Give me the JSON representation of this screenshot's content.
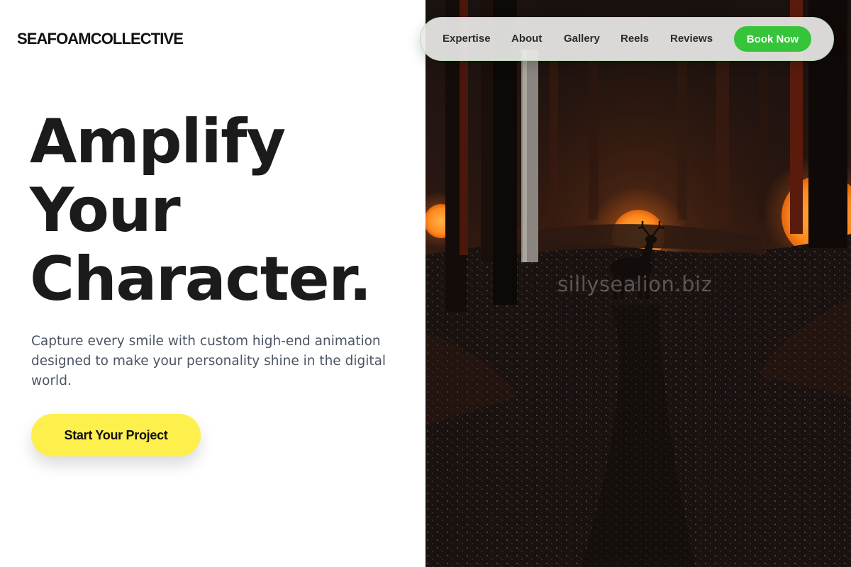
{
  "brand": {
    "logo": "SEAFOAMCOLLECTIVE"
  },
  "nav": {
    "items": [
      {
        "label": "Expertise"
      },
      {
        "label": "About"
      },
      {
        "label": "Gallery"
      },
      {
        "label": "Reels"
      },
      {
        "label": "Reviews"
      }
    ],
    "cta_label": "Book Now"
  },
  "hero": {
    "headline_lines": [
      "Amplify",
      "Your",
      "Character."
    ],
    "subtext": "Capture every smile with custom high-end animation designed to make your personality shine in the digital world.",
    "cta_label": "Start Your Project"
  },
  "image": {
    "description_icon": "forest-deer-illustration",
    "watermark": "sillysealion.biz"
  },
  "colors": {
    "cta_yellow": "#fdf04d",
    "book_green": "#35c43a",
    "headline": "#1b1b1b",
    "subtext": "#4b5563",
    "glow_orange": "#ff8a1f"
  }
}
